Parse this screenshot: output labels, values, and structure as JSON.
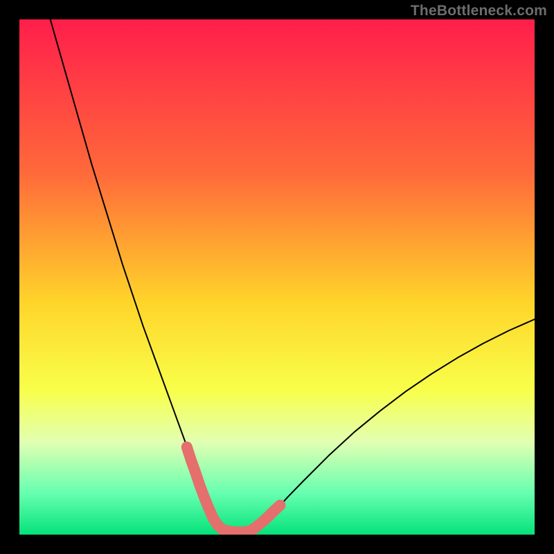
{
  "watermark": "TheBottleneck.com",
  "chart_data": {
    "type": "line",
    "title": "",
    "xlabel": "",
    "ylabel": "",
    "xlim": [
      0,
      100
    ],
    "ylim": [
      0,
      100
    ],
    "background_gradient_stops": [
      {
        "offset": 0.0,
        "color": "#ff1e4b"
      },
      {
        "offset": 0.3,
        "color": "#ff6a3a"
      },
      {
        "offset": 0.55,
        "color": "#ffd52a"
      },
      {
        "offset": 0.72,
        "color": "#f8ff4a"
      },
      {
        "offset": 0.82,
        "color": "#e2ffb2"
      },
      {
        "offset": 0.92,
        "color": "#66ffb0"
      },
      {
        "offset": 1.0,
        "color": "#05e27a"
      }
    ],
    "series": [
      {
        "name": "bottleneck-curve",
        "color": "#000000",
        "x": [
          6,
          8,
          10,
          12,
          14,
          16,
          18,
          20,
          22,
          24,
          26,
          28,
          30,
          32,
          33,
          34,
          35,
          36,
          37,
          38,
          39,
          40,
          41,
          42,
          43,
          44,
          45,
          46,
          48,
          50,
          52,
          55,
          60,
          65,
          70,
          75,
          80,
          85,
          90,
          95,
          100
        ],
        "y": [
          100,
          93,
          86,
          79,
          72,
          65.5,
          59,
          52.5,
          46.5,
          40.5,
          35,
          29.5,
          24,
          18.5,
          15.8,
          13.0,
          10.4,
          7.8,
          5.2,
          3.0,
          1.6,
          0.8,
          0.5,
          0.5,
          0.5,
          0.6,
          0.9,
          1.5,
          3.0,
          5.0,
          7.2,
          10.3,
          15.3,
          19.9,
          24.0,
          27.8,
          31.2,
          34.3,
          37.1,
          39.6,
          41.8
        ]
      }
    ],
    "markers": [
      {
        "name": "highlight-left",
        "color": "#e46f6c",
        "x": [
          32.5,
          33.3,
          34.2,
          35.0,
          35.9,
          36.8,
          37.6,
          38.5,
          39.4,
          40.5
        ],
        "y": [
          17.0,
          14.5,
          12.0,
          9.6,
          7.2,
          5.0,
          3.2,
          1.8,
          1.0,
          0.7
        ]
      },
      {
        "name": "highlight-bottom",
        "color": "#e46f6c",
        "x": [
          40.5,
          42.0,
          43.5,
          45.0
        ],
        "y": [
          0.7,
          0.5,
          0.5,
          0.8
        ]
      },
      {
        "name": "highlight-right",
        "color": "#e46f6c",
        "x": [
          45.0,
          46.1,
          47.2,
          48.3,
          49.4,
          50.6
        ],
        "y": [
          0.8,
          1.6,
          2.5,
          3.5,
          4.6,
          5.7
        ]
      }
    ]
  }
}
